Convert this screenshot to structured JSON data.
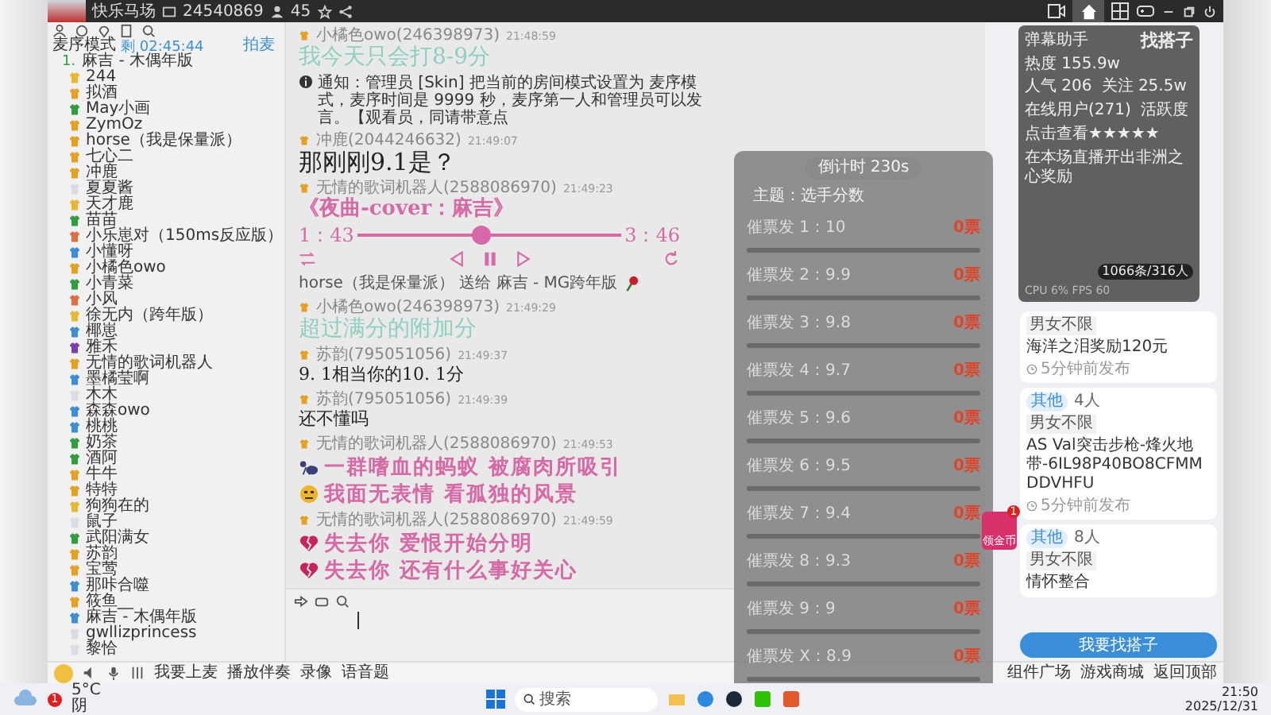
{
  "top_bar": {
    "room_name": "快乐马场",
    "room_id": "24540869",
    "online_count": "45"
  },
  "left_panel": {
    "mode": "麦序模式",
    "timer": "剩 02:45:44",
    "mic_link": "拍麦",
    "queue": [
      {
        "index": "1.",
        "name": "麻吉 - 木偶年版"
      }
    ],
    "users": [
      {
        "name": "244",
        "color": "#e8b830"
      },
      {
        "name": "拟酒",
        "color": "#e8a020"
      },
      {
        "name": "May小画",
        "color": "#2e9e3e"
      },
      {
        "name": "ZymOz",
        "color": "#e8a020"
      },
      {
        "name": "horse（我是保量派）",
        "color": "#e8a020"
      },
      {
        "name": "七心二",
        "color": "#e8a020"
      },
      {
        "name": "冲鹿",
        "color": "#e8a020"
      },
      {
        "name": "夏夏酱",
        "color": "#d8dde3"
      },
      {
        "name": "天才鹿",
        "color": "#e8b830"
      },
      {
        "name": "苗苗",
        "color": "#2e9e3e"
      },
      {
        "name": "小乐崽对（150ms反应版）",
        "color": "#e07040"
      },
      {
        "name": "小懂呀",
        "color": "#3a8fd8"
      },
      {
        "name": "小橘色owo",
        "color": "#e8a020"
      },
      {
        "name": "小青菜",
        "color": "#2e9e3e"
      },
      {
        "name": "小风",
        "color": "#e07040"
      },
      {
        "name": "徐无内（跨年版）",
        "color": "#e8b830"
      },
      {
        "name": "椰崽",
        "color": "#3a8fd8"
      },
      {
        "name": "雅禾",
        "color": "#7a3fb0"
      },
      {
        "name": "无情的歌词机器人",
        "color": "#e8a020"
      },
      {
        "name": "墨橘莹啊",
        "color": "#3a8fd8"
      },
      {
        "name": "木木",
        "color": "#d8dde3"
      },
      {
        "name": "森森owo",
        "color": "#3a8fd8"
      },
      {
        "name": "桃桃",
        "color": "#3a8fd8"
      },
      {
        "name": "奶茶",
        "color": "#2e9e3e"
      },
      {
        "name": "酒阿",
        "color": "#2e9e3e"
      },
      {
        "name": "牛牛",
        "color": "#e8a020"
      },
      {
        "name": "特特",
        "color": "#e8a020"
      },
      {
        "name": "狗狗在的",
        "color": "#e8b830"
      },
      {
        "name": "鼠子",
        "color": "#d8dde3"
      },
      {
        "name": "武阳满女",
        "color": "#2e9e3e"
      },
      {
        "name": "苏韵",
        "color": "#e8a020"
      },
      {
        "name": "宝莺",
        "color": "#e8a020"
      },
      {
        "name": "那咔合噬",
        "color": "#3a8fd8"
      },
      {
        "name": "筱鱼__",
        "color": "#e8a020"
      },
      {
        "name": "麻吉 - 木偶年版",
        "color": "#3a8fd8"
      },
      {
        "name": "gwllizprincess",
        "color": "#d8dde3"
      },
      {
        "name": "黎恰",
        "color": "#d8dde3"
      }
    ]
  },
  "chat": {
    "messages": [
      {
        "kind": "faded",
        "sender": "小橘色owo(246398973)",
        "time": "21:48:59",
        "text": "我今天只会打8-9分"
      },
      {
        "kind": "notice",
        "text": "通知：管理员 [Skin] 把当前的房间模式设置为 麦序模式，麦序时间是 9999 秒，麦序第一人和管理员可以发言。【观看员，同请带意点"
      },
      {
        "kind": "large",
        "sender": "冲鹿(2044246632)",
        "time": "21:49:07",
        "text": "那刚刚9.1是？"
      },
      {
        "kind": "music",
        "sender": "无情的歌词机器人(2588086970)",
        "time": "21:49:23",
        "title": "《夜曲-cover：麻吉》",
        "elapsed": "1：43",
        "total": "3：46",
        "level": 0.47
      },
      {
        "kind": "gift",
        "text": "horse（我是保量派） 送给 麻吉 - MG跨年版"
      },
      {
        "kind": "faded",
        "sender": "小橘色owo(246398973)",
        "time": "21:49:29",
        "text": "超过满分的附加分"
      },
      {
        "kind": "text",
        "sender": "苏韵(795051056)",
        "time": "21:49:37",
        "text": "9. 1相当你的10. 1分"
      },
      {
        "kind": "text",
        "sender": "苏韵(795051056)",
        "time": "21:49:39",
        "text": "还不懂吗"
      },
      {
        "kind": "lyrics",
        "sender": "无情的歌词机器人(2588086970)",
        "time": "21:49:53",
        "lines": [
          {
            "kind": "ant",
            "text": "一群嗜血的蚂蚁 被腐肉所吸引"
          },
          {
            "kind": "face",
            "text": "我面无表情 看孤独的风景"
          }
        ]
      },
      {
        "kind": "lyrics",
        "sender": "无情的歌词机器人(2588086970)",
        "time": "21:49:59",
        "lines": [
          {
            "kind": "heart",
            "text": "失去你 爱恨开始分明"
          },
          {
            "kind": "heart",
            "text": "失去你 还有什么事好关心"
          }
        ]
      }
    ]
  },
  "vote_panel": {
    "countdown": "倒计时 230s",
    "topic": "主题：选手分数",
    "options": [
      {
        "label": "催票发 1：10",
        "votes": "0票",
        "level": 0
      },
      {
        "label": "催票发 2：9.9",
        "votes": "0票",
        "level": 0
      },
      {
        "label": "催票发 3：9.8",
        "votes": "0票",
        "level": 0
      },
      {
        "label": "催票发 4：9.7",
        "votes": "0票",
        "level": 0
      },
      {
        "label": "催票发 5：9.6",
        "votes": "0票",
        "level": 0
      },
      {
        "label": "催票发 6：9.5",
        "votes": "0票",
        "level": 0
      },
      {
        "label": "催票发 7：9.4",
        "votes": "0票",
        "level": 0
      },
      {
        "label": "催票发 8：9.3",
        "votes": "0票",
        "level": 0
      },
      {
        "label": "催票发 9：9",
        "votes": "0票",
        "level": 0
      },
      {
        "label": "催票发 X：8.9",
        "votes": "0票",
        "level": 0
      }
    ]
  },
  "red_envelope": {
    "label": "领金币",
    "count": "1"
  },
  "assistant_panel": {
    "title": "弹幕助手",
    "heading": "找搭子",
    "stats": [
      "热度 155.9w",
      "人气 206",
      "关注 25.5w"
    ],
    "tabs": [
      "在线用户(271)",
      "活跃度"
    ],
    "lines": [
      "点击查看★★★★★",
      "在本场直播开出非洲之心奖励"
    ],
    "counter": "1066条/316人",
    "footer": "CPU 6%  FPS 60"
  },
  "partner_panel": {
    "cards": [
      {
        "tag": "男女不限",
        "text": "海洋之泪奖励120元",
        "posted": "5分钟前发布"
      },
      {
        "category": "其他",
        "members": "4人",
        "tag": "男女不限",
        "text": "AS Val突击步枪-烽火地带-6IL98P40BO8CFMMDDVHFU",
        "posted": "5分钟前发布"
      },
      {
        "category": "其他",
        "members": "8人",
        "tag": "男女不限",
        "text": "情怀整合"
      }
    ],
    "button": "我要找搭子"
  },
  "toolbar": {
    "left": [
      "我要上麦",
      "播放伴奏",
      "录像",
      "语音题"
    ],
    "right": [
      "组件广场",
      "游戏商城",
      "返回顶部"
    ]
  },
  "taskbar": {
    "temperature": "5°C",
    "weather": "阴",
    "search": "搜索",
    "time": "21:50",
    "date": "2025/12/31",
    "notifications": "1"
  }
}
